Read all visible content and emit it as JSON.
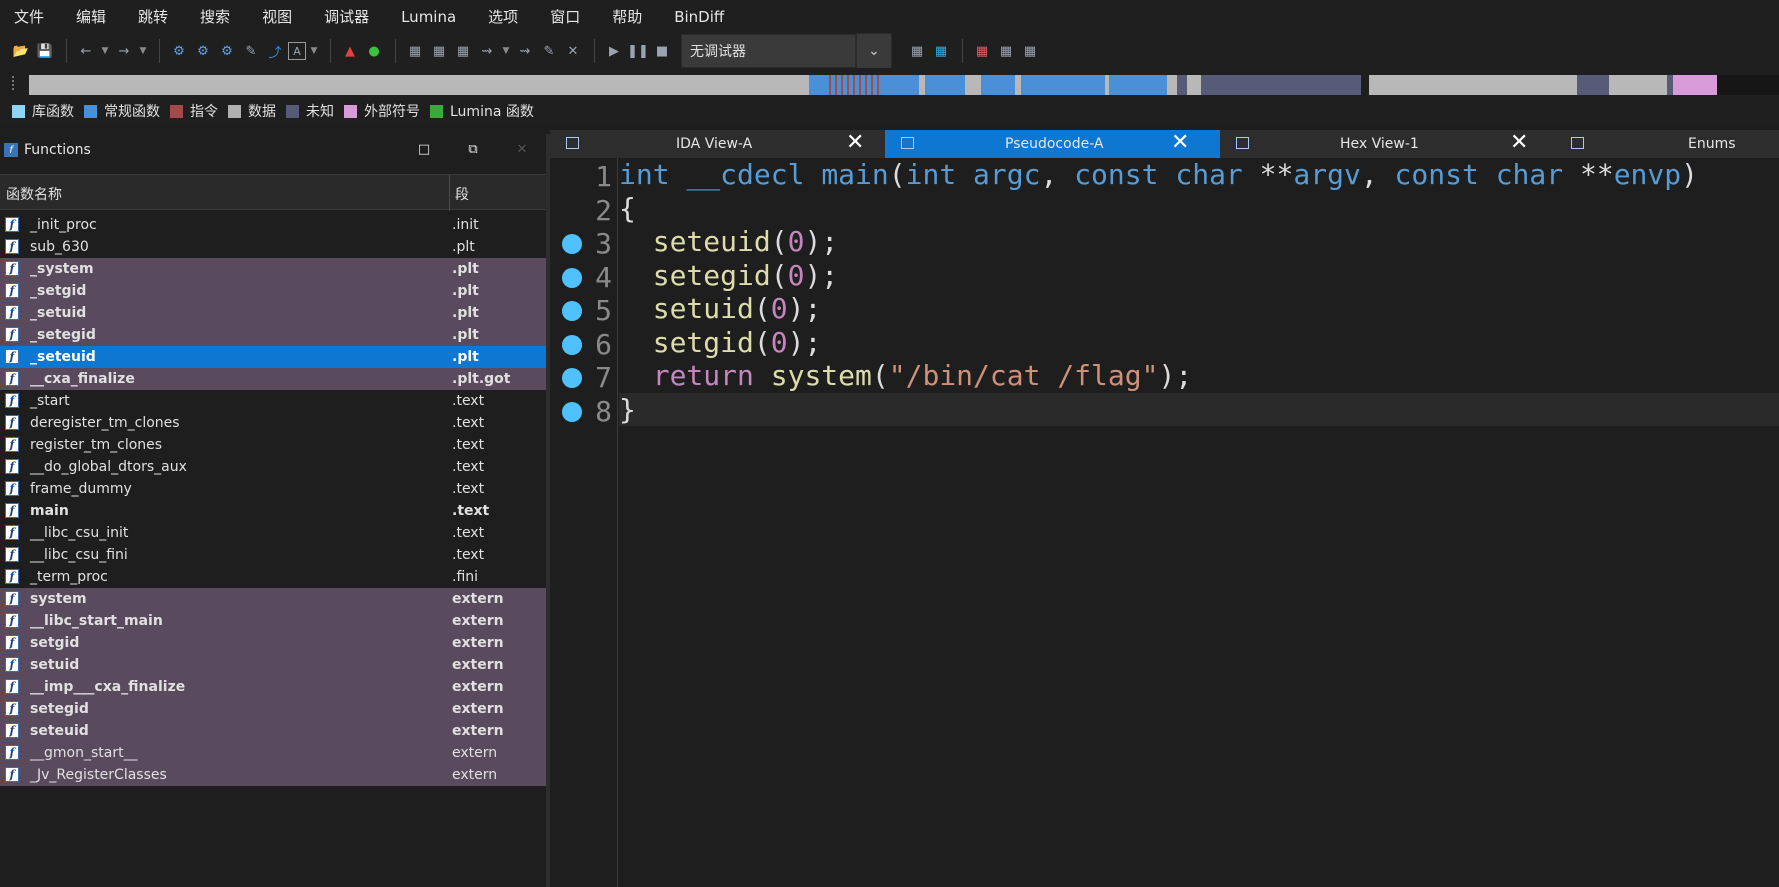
{
  "menu": [
    "文件",
    "编辑",
    "跳转",
    "搜索",
    "视图",
    "调试器",
    "Lumina",
    "选项",
    "窗口",
    "帮助",
    "BinDiff"
  ],
  "toolbar": {
    "debugger_select": "无调试器"
  },
  "legend": [
    {
      "label": "库函数",
      "color": "#8fd3f5"
    },
    {
      "label": "常规函数",
      "color": "#4a90d9"
    },
    {
      "label": "指令",
      "color": "#a34a4a"
    },
    {
      "label": "数据",
      "color": "#b0b0b0"
    },
    {
      "label": "未知",
      "color": "#585b78"
    },
    {
      "label": "外部符号",
      "color": "#d89ad8"
    },
    {
      "label": "Lumina 函数",
      "color": "#3ca93c"
    }
  ],
  "functions_panel": {
    "title": "Functions",
    "col_name": "函数名称",
    "col_segment": "段",
    "rows": [
      {
        "name": "_init_proc",
        "seg": ".init",
        "style": "normal"
      },
      {
        "name": "sub_630",
        "seg": ".plt",
        "style": "normal"
      },
      {
        "name": "_system",
        "seg": ".plt",
        "style": "imp"
      },
      {
        "name": "_setgid",
        "seg": ".plt",
        "style": "imp"
      },
      {
        "name": "_setuid",
        "seg": ".plt",
        "style": "imp"
      },
      {
        "name": "_setegid",
        "seg": ".plt",
        "style": "imp"
      },
      {
        "name": "_seteuid",
        "seg": ".plt",
        "style": "sel"
      },
      {
        "name": "__cxa_finalize",
        "seg": ".plt.got",
        "style": "imp"
      },
      {
        "name": "_start",
        "seg": ".text",
        "style": "normal"
      },
      {
        "name": "deregister_tm_clones",
        "seg": ".text",
        "style": "normal"
      },
      {
        "name": "register_tm_clones",
        "seg": ".text",
        "style": "normal"
      },
      {
        "name": "__do_global_dtors_aux",
        "seg": ".text",
        "style": "normal"
      },
      {
        "name": "frame_dummy",
        "seg": ".text",
        "style": "normal"
      },
      {
        "name": "main",
        "seg": ".text",
        "style": "bold"
      },
      {
        "name": "__libc_csu_init",
        "seg": ".text",
        "style": "normal"
      },
      {
        "name": "__libc_csu_fini",
        "seg": ".text",
        "style": "normal"
      },
      {
        "name": "_term_proc",
        "seg": ".fini",
        "style": "normal"
      },
      {
        "name": "system",
        "seg": "extern",
        "style": "imp"
      },
      {
        "name": "__libc_start_main",
        "seg": "extern",
        "style": "imp"
      },
      {
        "name": "setgid",
        "seg": "extern",
        "style": "imp"
      },
      {
        "name": "setuid",
        "seg": "extern",
        "style": "imp"
      },
      {
        "name": "__imp___cxa_finalize",
        "seg": "extern",
        "style": "imp"
      },
      {
        "name": "setegid",
        "seg": "extern",
        "style": "imp"
      },
      {
        "name": "seteuid",
        "seg": "extern",
        "style": "imp"
      },
      {
        "name": "__gmon_start__",
        "seg": "extern",
        "style": "impn"
      },
      {
        "name": "_Jv_RegisterClasses",
        "seg": "extern",
        "style": "impn"
      }
    ]
  },
  "tabs": [
    {
      "label": "IDA View-A",
      "active": false
    },
    {
      "label": "Pseudocode-A",
      "active": true
    },
    {
      "label": "Hex View-1",
      "active": false
    },
    {
      "label": "Enums",
      "active": false
    }
  ],
  "code": [
    {
      "n": "1",
      "text": "int __cdecl main(int argc, const char **argv, const char **envp)",
      "bp": false
    },
    {
      "n": "2",
      "text": "{",
      "bp": false
    },
    {
      "n": "3",
      "text": "  seteuid(0);",
      "bp": true
    },
    {
      "n": "4",
      "text": "  setegid(0);",
      "bp": true
    },
    {
      "n": "5",
      "text": "  setuid(0);",
      "bp": true
    },
    {
      "n": "6",
      "text": "  setgid(0);",
      "bp": true
    },
    {
      "n": "7",
      "text": "  return system(\"/bin/cat /flag\");",
      "bp": true
    },
    {
      "n": "8",
      "text": "}",
      "bp": true
    }
  ]
}
